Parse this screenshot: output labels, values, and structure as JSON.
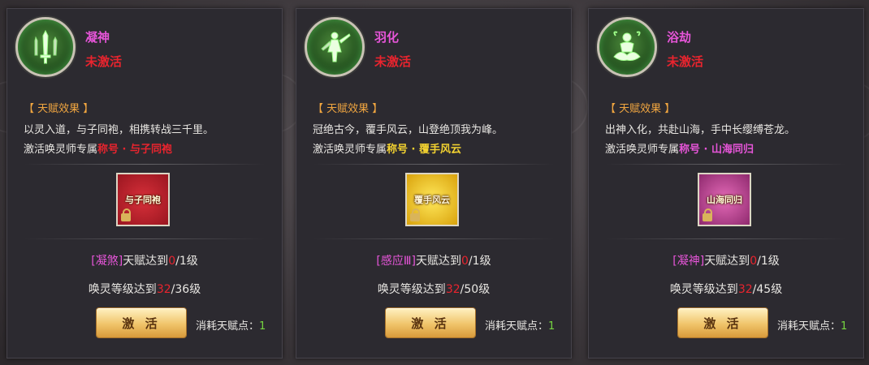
{
  "section_header": "【 天赋效果 】",
  "activate_label": "激 活",
  "cost_label": "消耗天赋点：",
  "req_level_label": "天赋达到",
  "req_level_sep": "/",
  "req_level_suffix": "级",
  "req_summon_label": "唤灵等级达到",
  "unlock_prefix": "激活唤灵师专属",
  "title_word": "称号",
  "title_sep": " · ",
  "cards": [
    {
      "name": "凝神",
      "status": "未激活",
      "icon": "sword-icon",
      "desc": "以灵入道，与子同袍，相携转战三千里。",
      "title_name": "与子同袍",
      "title_color": "#e8242e",
      "badge_text": "与子同袍",
      "badge_color": "#b8202a",
      "req_talent": "[凝煞]",
      "req_current": "0",
      "req_max": "1",
      "summon_current": "32",
      "summon_max": "36",
      "cost": "1"
    },
    {
      "name": "羽化",
      "status": "未激活",
      "icon": "warrior-icon",
      "desc": "冠绝古今，覆手风云，山登绝顶我为峰。",
      "title_name": "覆手风云",
      "title_color": "#f3d230",
      "badge_text": "覆手风云",
      "badge_color": "#e0b010",
      "req_talent": "[感应Ⅲ]",
      "req_current": "0",
      "req_max": "1",
      "summon_current": "32",
      "summon_max": "50",
      "cost": "1"
    },
    {
      "name": "浴劫",
      "status": "未激活",
      "icon": "lotus-figure-icon",
      "desc": "出神入化，共赴山海，手中长缨缚苍龙。",
      "title_name": "山海同归",
      "title_color": "#e655d8",
      "badge_text": "山海同归",
      "badge_color": "#c24a9a",
      "req_talent": "[凝神]",
      "req_current": "0",
      "req_max": "1",
      "summon_current": "32",
      "summon_max": "45",
      "cost": "1"
    }
  ]
}
